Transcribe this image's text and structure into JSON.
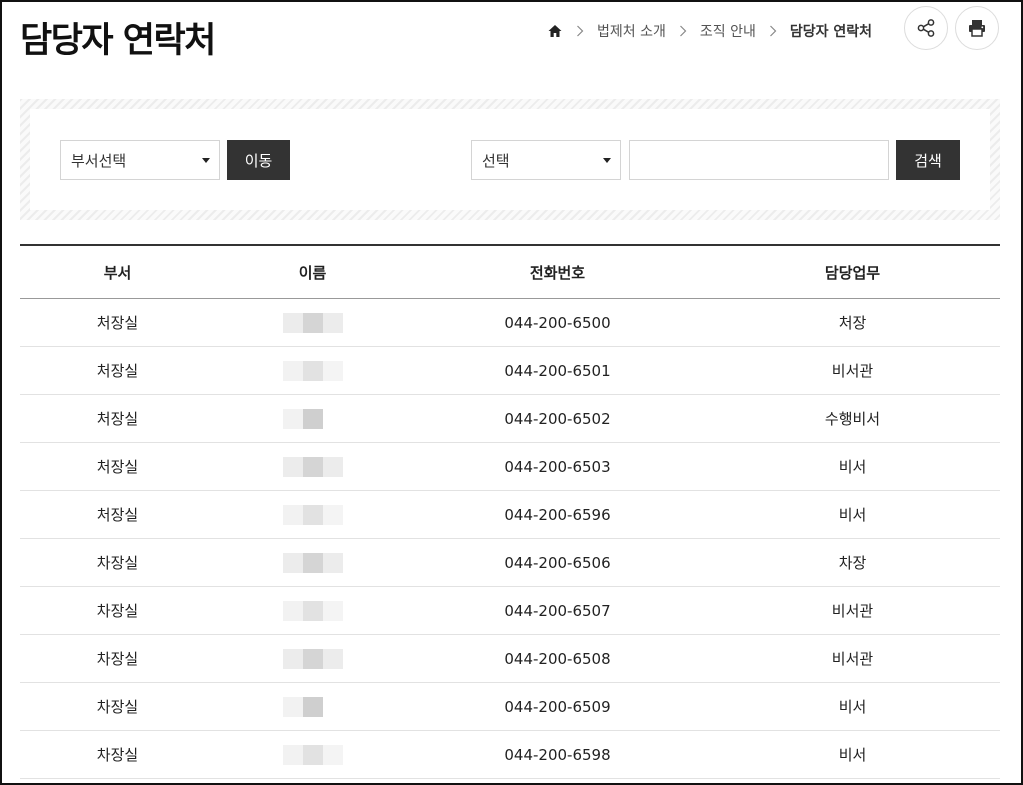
{
  "page": {
    "title": "담당자 연락처"
  },
  "breadcrumb": {
    "items": [
      "법제처 소개",
      "조직 안내",
      "담당자 연락처"
    ]
  },
  "actions": {
    "share_icon": "share-icon",
    "print_icon": "print-icon"
  },
  "search": {
    "dept_select_value": "부서선택",
    "move_label": "이동",
    "field_select_value": "선택",
    "keyword_value": "",
    "search_label": "검색"
  },
  "table": {
    "headers": [
      "부서",
      "이름",
      "전화번호",
      "담당업무"
    ],
    "rows": [
      {
        "dept": "처장실",
        "phone": "044-200-6500",
        "duty": "처장"
      },
      {
        "dept": "처장실",
        "phone": "044-200-6501",
        "duty": "비서관"
      },
      {
        "dept": "처장실",
        "phone": "044-200-6502",
        "duty": "수행비서"
      },
      {
        "dept": "처장실",
        "phone": "044-200-6503",
        "duty": "비서"
      },
      {
        "dept": "처장실",
        "phone": "044-200-6596",
        "duty": "비서"
      },
      {
        "dept": "차장실",
        "phone": "044-200-6506",
        "duty": "차장"
      },
      {
        "dept": "차장실",
        "phone": "044-200-6507",
        "duty": "비서관"
      },
      {
        "dept": "차장실",
        "phone": "044-200-6508",
        "duty": "비서관"
      },
      {
        "dept": "차장실",
        "phone": "044-200-6509",
        "duty": "비서"
      },
      {
        "dept": "차장실",
        "phone": "044-200-6598",
        "duty": "비서"
      }
    ]
  },
  "colors": {
    "button_dark": "#333333",
    "border_light": "#d4d4d4",
    "text": "#222222"
  }
}
